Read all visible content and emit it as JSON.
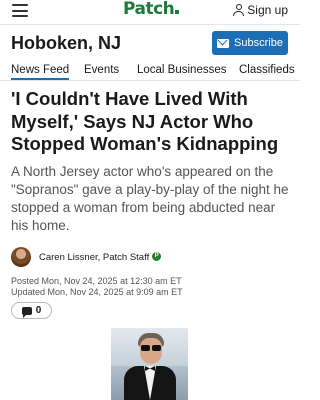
{
  "header": {
    "logo": "Patch",
    "signin_label": "Sign up"
  },
  "city": {
    "name": "Hoboken, NJ",
    "subscribe_label": "Subscribe"
  },
  "tabs": [
    {
      "label": "News Feed",
      "active": true
    },
    {
      "label": "Events",
      "active": false
    },
    {
      "label": "Local Businesses",
      "active": false
    },
    {
      "label": "Classifieds",
      "active": false
    }
  ],
  "article": {
    "headline": "'I Couldn't Have Lived With Myself,' Says NJ Actor Who Stopped Woman's Kidnapping",
    "dek": "A North Jersey actor who's appeared on the \"Sopranos\" gave a play-by-play of the night he stopped a woman from being abducted near his home.",
    "author": "Caren Lissner",
    "author_role": ", Patch Staff",
    "badge": "P",
    "posted": "Posted Mon, Nov 24, 2025 at 12:30 am ET",
    "updated": "Updated Mon, Nov 24, 2025 at 9:09 am ET",
    "comment_count": "0"
  },
  "colors": {
    "brand_green": "#1e7a3a",
    "subscribe_blue": "#1d6fb5",
    "staff_badge_green": "#2e7d32"
  }
}
